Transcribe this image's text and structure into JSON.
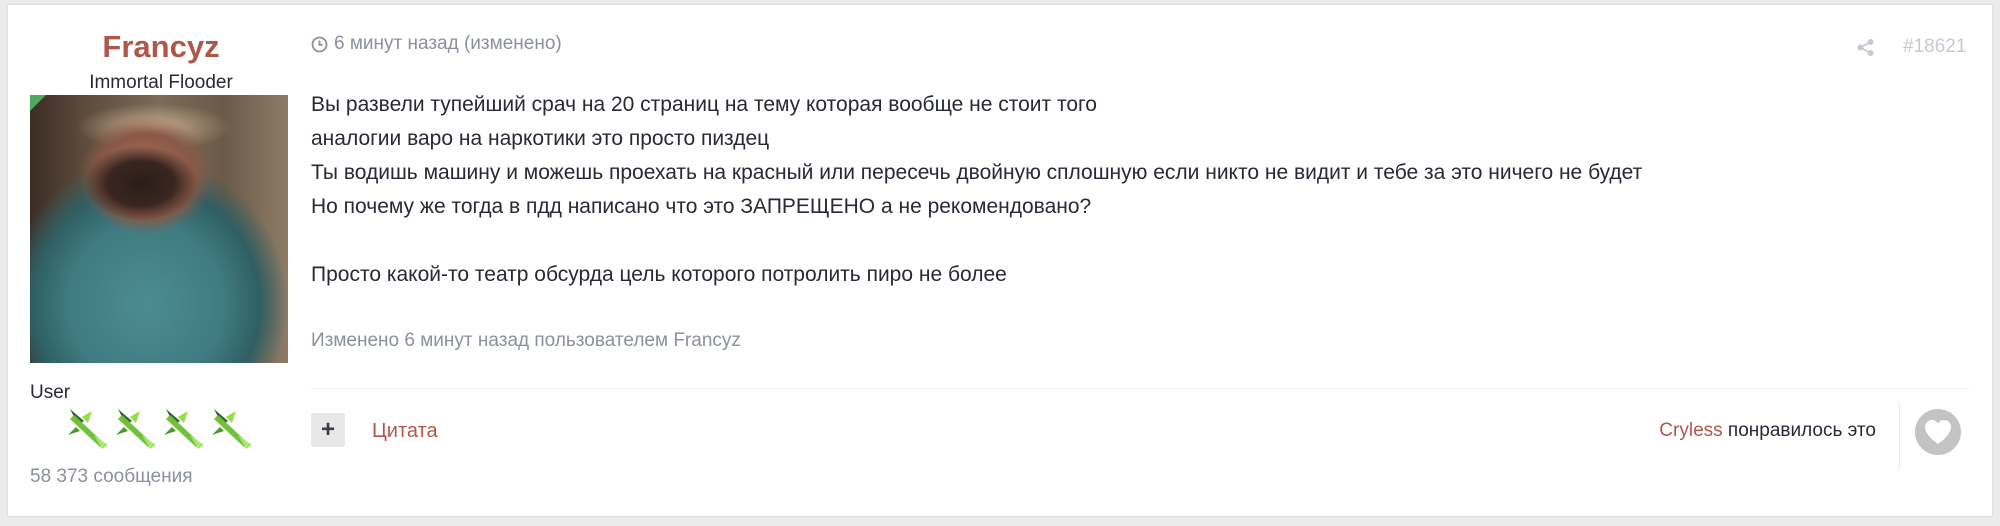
{
  "author": {
    "name": "Francyz",
    "title": "Immortal Flooder",
    "role": "User",
    "post_count": "58 373 сообщения",
    "badge_count": 4
  },
  "post": {
    "timestamp": "6 минут назад (изменено)",
    "number": "#18621",
    "lines": [
      "Вы развели тупейший срач на 20 страниц на тему которая вообще не стоит того",
      "аналогии варо на наркотики это просто пиздец",
      "Ты водишь машину и можешь проехать на красный или пересечь двойную сплошную если никто не видит и тебе за это ничего не будет",
      "Но почему же тогда в пдд написано что это ЗАПРЕЩЕНО а не рекомендовано?",
      "",
      "Просто какой-то театр обсурда цель которого потролить пиро не более"
    ],
    "edited_note": "Изменено 6 минут назад пользователем Francyz"
  },
  "actions": {
    "plus_label": "+",
    "quote_label": "Цитата",
    "liker_name": "Cryless",
    "liked_text": " понравилось это"
  },
  "icons": {
    "clock": "clock-icon",
    "share": "share-icon",
    "heart": "heart-icon",
    "badge": "gem-wand-badge-icon"
  },
  "colors": {
    "accent": "#b0574b",
    "muted": "#8b909e",
    "badge_green": "#6fc23a",
    "like_gray": "#c3c3c3"
  }
}
